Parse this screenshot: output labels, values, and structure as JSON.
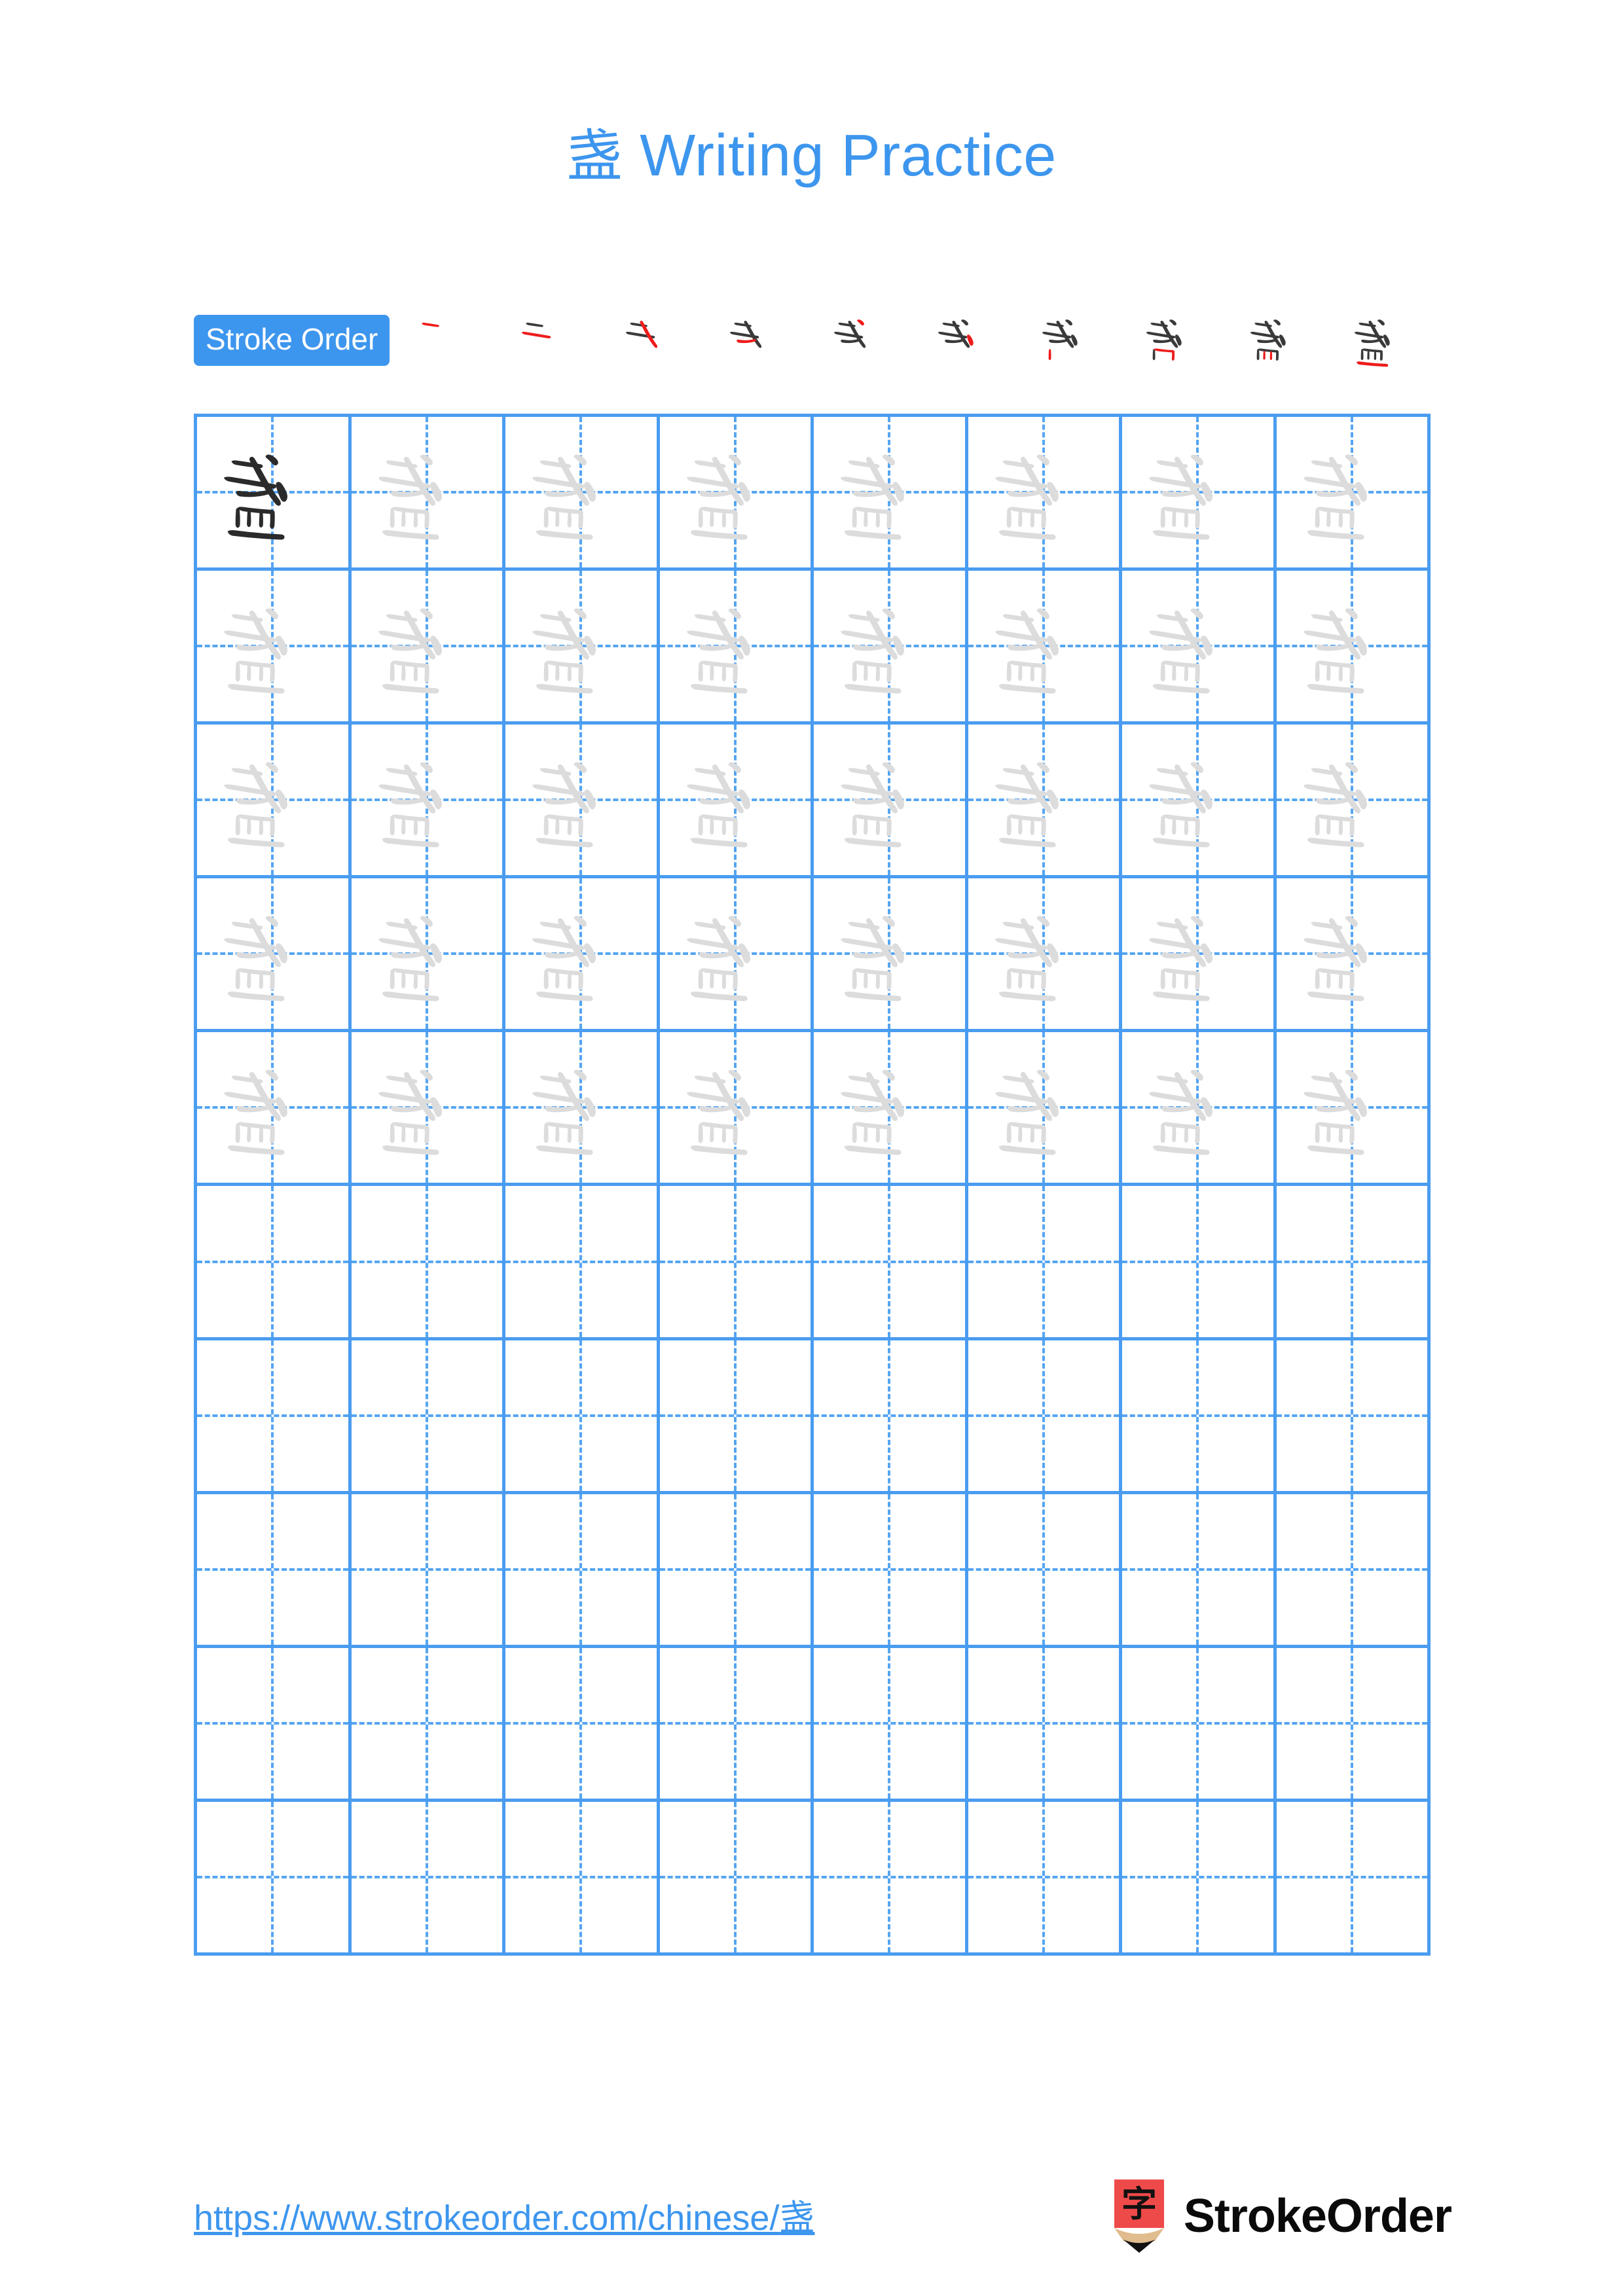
{
  "page": {
    "character": "盏",
    "title": "盏 Writing Practice",
    "title_character": "盏",
    "title_text": " Writing Practice",
    "background_color": "#ffffff",
    "accent_color": "#3d96ee",
    "grid_line_color": "#4a9cf0",
    "guide_line_color": "#55a5f2",
    "trace_character_color": "#dcdcdc",
    "model_character_color": "#2b2b2b",
    "new_stroke_color": "#ee1c1c",
    "prior_stroke_color": "#3a3a3a"
  },
  "stroke_order": {
    "label": "Stroke Order",
    "total_steps": 10,
    "steps": [
      {
        "index": 1,
        "strokes_shown": 1,
        "new_stroke_index": 1
      },
      {
        "index": 2,
        "strokes_shown": 2,
        "new_stroke_index": 2
      },
      {
        "index": 3,
        "strokes_shown": 3,
        "new_stroke_index": 3
      },
      {
        "index": 4,
        "strokes_shown": 4,
        "new_stroke_index": 4
      },
      {
        "index": 5,
        "strokes_shown": 5,
        "new_stroke_index": 5
      },
      {
        "index": 6,
        "strokes_shown": 6,
        "new_stroke_index": 6
      },
      {
        "index": 7,
        "strokes_shown": 7,
        "new_stroke_index": 7
      },
      {
        "index": 8,
        "strokes_shown": 8,
        "new_stroke_index": 8
      },
      {
        "index": 9,
        "strokes_shown": 9,
        "new_stroke_index": 9
      },
      {
        "index": 10,
        "strokes_shown": 10,
        "new_stroke_index": 10
      }
    ]
  },
  "practice_grid": {
    "rows": 10,
    "columns": 8,
    "cells": [
      [
        "model",
        "trace",
        "trace",
        "trace",
        "trace",
        "trace",
        "trace",
        "trace"
      ],
      [
        "trace",
        "trace",
        "trace",
        "trace",
        "trace",
        "trace",
        "trace",
        "trace"
      ],
      [
        "trace",
        "trace",
        "trace",
        "trace",
        "trace",
        "trace",
        "trace",
        "trace"
      ],
      [
        "trace",
        "trace",
        "trace",
        "trace",
        "trace",
        "trace",
        "trace",
        "trace"
      ],
      [
        "trace",
        "trace",
        "trace",
        "trace",
        "trace",
        "trace",
        "trace",
        "trace"
      ],
      [
        "empty",
        "empty",
        "empty",
        "empty",
        "empty",
        "empty",
        "empty",
        "empty"
      ],
      [
        "empty",
        "empty",
        "empty",
        "empty",
        "empty",
        "empty",
        "empty",
        "empty"
      ],
      [
        "empty",
        "empty",
        "empty",
        "empty",
        "empty",
        "empty",
        "empty",
        "empty"
      ],
      [
        "empty",
        "empty",
        "empty",
        "empty",
        "empty",
        "empty",
        "empty",
        "empty"
      ],
      [
        "empty",
        "empty",
        "empty",
        "empty",
        "empty",
        "empty",
        "empty",
        "empty"
      ]
    ]
  },
  "footer": {
    "url": "https://www.strokeorder.com/chinese/盏",
    "url_base": "https://www.strokeorder.com/chinese/",
    "url_character": "盏",
    "brand_name": "StrokeOrder",
    "brand_mark_character": "字",
    "brand_mark_body_color": "#ef4a4a",
    "brand_mark_wood_color": "#e0bc8e",
    "brand_mark_tip_color": "#111111"
  }
}
